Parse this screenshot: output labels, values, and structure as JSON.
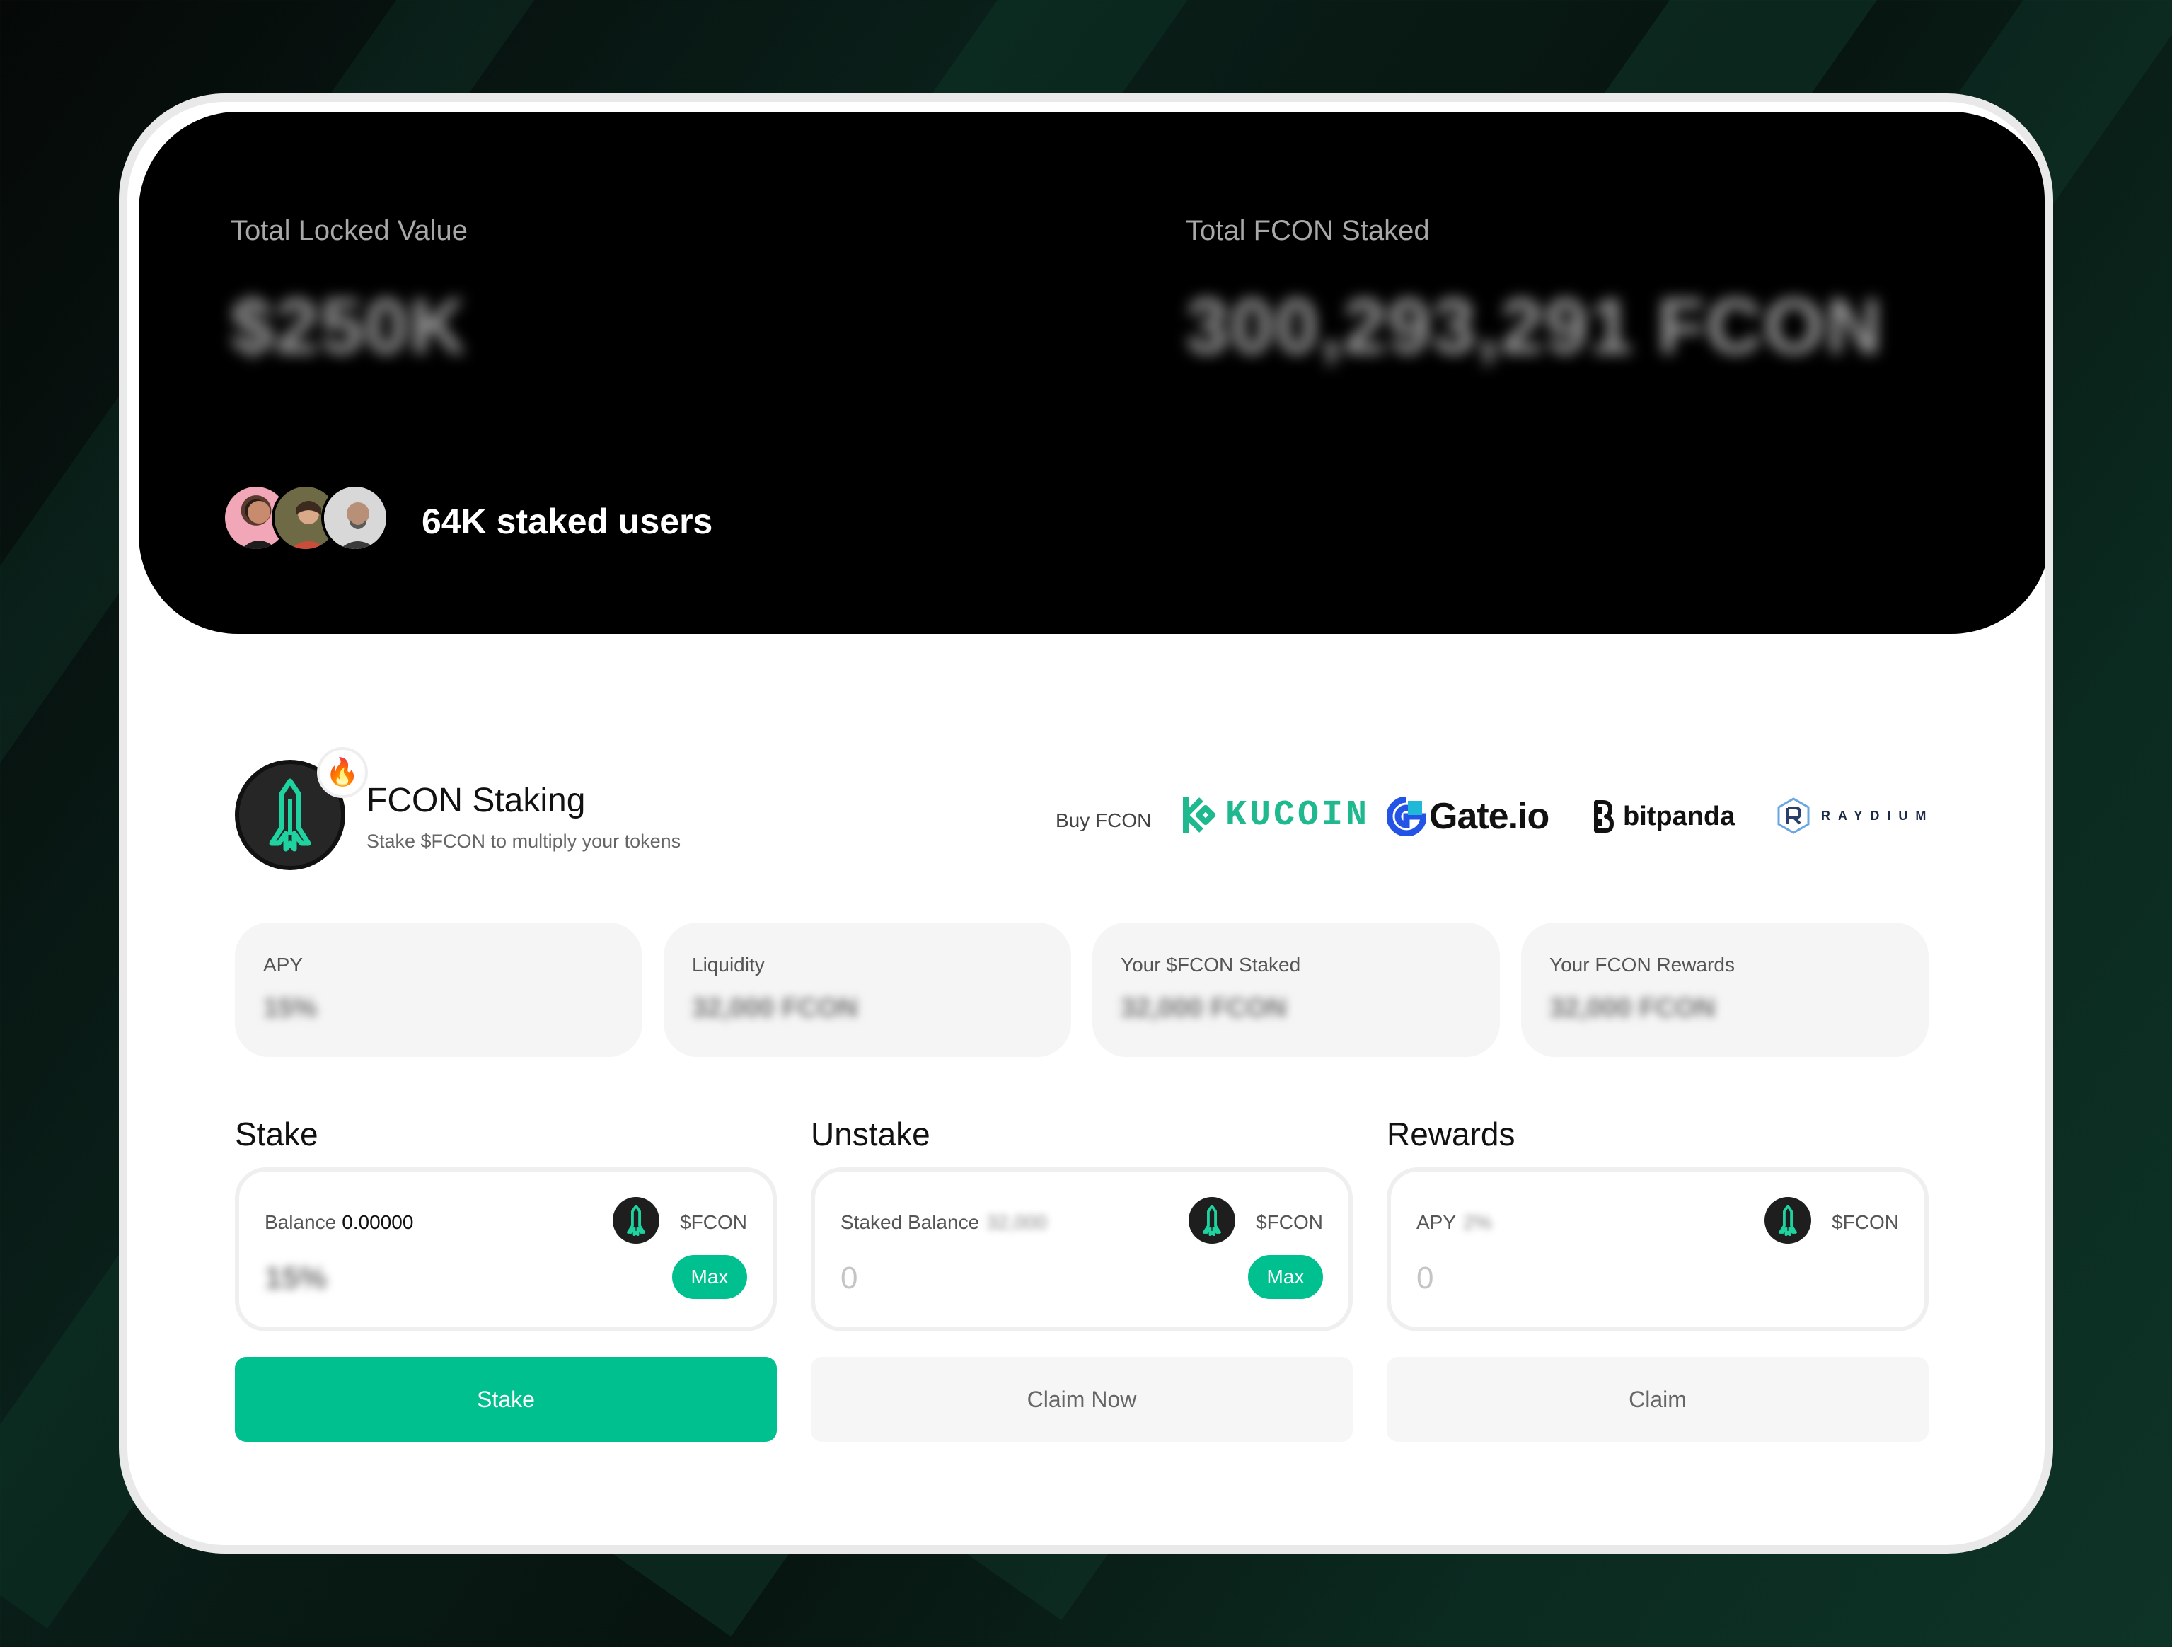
{
  "hero": {
    "total_locked_label": "Total Locked Value",
    "total_locked_value": "$250K",
    "total_staked_label": "Total FCON Staked",
    "total_staked_value": "300,293,291 FCON",
    "users_text": "64K staked users"
  },
  "header": {
    "title": "FCON Staking",
    "subtitle": "Stake $FCON to multiply your tokens",
    "buy_label": "Buy FCON",
    "exchanges": [
      "KUCOIN",
      "Gate.io",
      "bitpanda",
      "RAYDIUM"
    ]
  },
  "stats": [
    {
      "label": "APY",
      "value": "15%"
    },
    {
      "label": "Liquidity",
      "value": "32,000 FCON"
    },
    {
      "label": "Your $FCON Staked",
      "value": "32,000 FCON"
    },
    {
      "label": "Your FCON Rewards",
      "value": "32,000 FCON"
    }
  ],
  "stake": {
    "title": "Stake",
    "balance_label": "Balance",
    "balance_value": "0.00000",
    "token": "$FCON",
    "amount": "15%",
    "max_label": "Max",
    "action_label": "Stake"
  },
  "unstake": {
    "title": "Unstake",
    "balance_label": "Staked Balance",
    "balance_value": "32,000",
    "token": "$FCON",
    "amount": "0",
    "max_label": "Max",
    "action_label": "Claim Now"
  },
  "rewards": {
    "title": "Rewards",
    "apy_label": "APY",
    "apy_value": "2%",
    "token": "$FCON",
    "amount": "0",
    "action_label": "Claim"
  },
  "colors": {
    "accent": "#00c08f",
    "hero_bg": "#000000",
    "kucoin": "#1fb88f",
    "gate": "#2354e6"
  }
}
